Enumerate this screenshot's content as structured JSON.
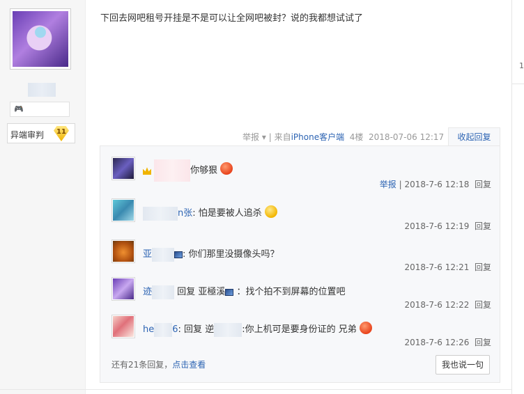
{
  "author": {
    "badge_name": "异端审判",
    "badge_level": "11"
  },
  "post": {
    "content": "下回去网吧租号开挂是不是可以让全网吧被封？说的我都想试试了",
    "meta": {
      "report": "举报",
      "dropdown": "▾",
      "separator": "|",
      "client_prefix": "来自",
      "client": "iPhone客户端",
      "floor": "4楼",
      "time": "2018-07-06 12:17"
    },
    "collapse_label": "收起回复"
  },
  "replies": [
    {
      "user_visible": "",
      "text": "你够狠",
      "report": "举报",
      "separator": "|",
      "time": "2018-7-6 12:18",
      "reply_label": "回复"
    },
    {
      "user_visible": "n张",
      "text": "怕是要被人追杀",
      "time": "2018-7-6 12:19",
      "reply_label": "回复"
    },
    {
      "user_visible": "亚",
      "text": "你们那里没摄像头吗？",
      "time": "2018-7-6 12:21",
      "reply_label": "回复"
    },
    {
      "user_visible": "迹",
      "reply_word": "回复",
      "target": "亚極溪",
      "text": "：找个拍不到屏幕的位置吧",
      "time": "2018-7-6 12:22",
      "reply_label": "回复"
    },
    {
      "user_visible": "he",
      "user_visible_tail": "6",
      "reply_word": "回复",
      "target": "逆",
      "text": "你上机可是要身份证的 兄弟",
      "time": "2018-7-6 12:26",
      "reply_label": "回复"
    }
  ],
  "footer": {
    "more_prefix": "还有21条回复，",
    "more_link": "点击查看",
    "say_button": "我也说一句"
  },
  "edge": {
    "page_digit": "1"
  },
  "colors": {
    "link": "#2d64b3",
    "panel_bg": "#f7f8fa",
    "left_bg": "#f6f6f6"
  }
}
